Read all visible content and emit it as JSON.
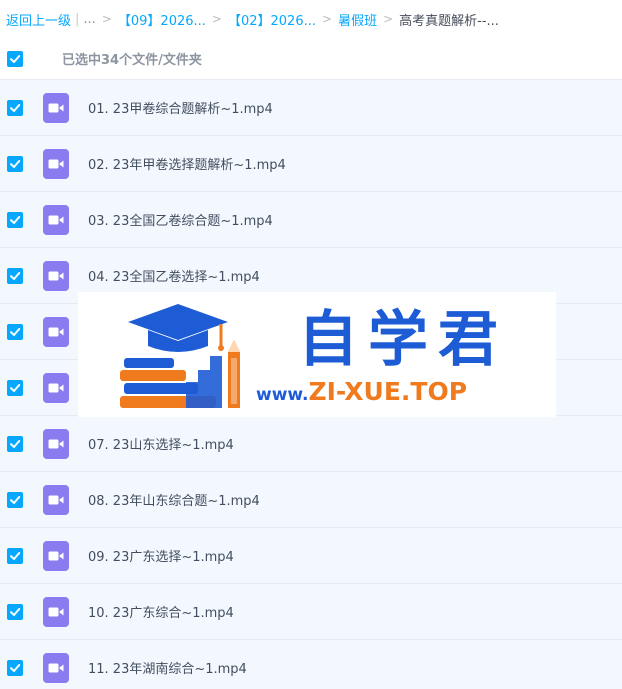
{
  "breadcrumb": {
    "back_label": "返回上一级",
    "pipe": "|",
    "ellipsis": "...",
    "sep": ">",
    "crumbs": [
      "【09】2026...",
      "【02】2026...",
      "暑假班"
    ],
    "current": "高考真题解析--..."
  },
  "selection": {
    "summary": "已选中34个文件/文件夹"
  },
  "files": [
    {
      "name": "01. 23甲卷综合题解析~1.mp4"
    },
    {
      "name": "02. 23年甲卷选择题解析~1.mp4"
    },
    {
      "name": "03. 23全国乙卷综合题~1.mp4"
    },
    {
      "name": "04. 23全国乙卷选择~1.mp4"
    },
    {
      "name": ""
    },
    {
      "name": ""
    },
    {
      "name": "07. 23山东选择~1.mp4"
    },
    {
      "name": "08. 23年山东综合题~1.mp4"
    },
    {
      "name": "09. 23广东选择~1.mp4"
    },
    {
      "name": "10. 23广东综合~1.mp4"
    },
    {
      "name": "11. 23年湖南综合~1.mp4"
    }
  ],
  "watermark": {
    "title": "自学君",
    "url_prefix": "www.",
    "url_main": "ZI-XUE.TOP"
  },
  "icons": {
    "checkbox": "checkbox-checked-icon",
    "file": "video-file-icon",
    "logo": "graduation-cap-books-icon"
  },
  "colors": {
    "accent": "#06a7ff",
    "row_bg": "#f3f8fe",
    "video_icon": "#8a7cf0",
    "watermark_blue": "#1e5cd6",
    "watermark_orange": "#f07b1f"
  }
}
